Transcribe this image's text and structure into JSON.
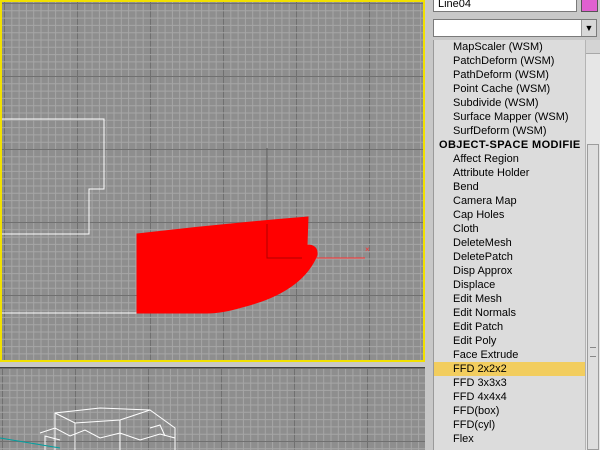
{
  "object_name": "Line04",
  "colors": {
    "grid_bg": "#8e8e8e",
    "grid_line": "#a6a6a6",
    "grid_major": "#707070",
    "active_border": "#f2e100",
    "shape_fill": "#ff0000",
    "outline": "#ffffff",
    "selected_item": "#f2cd5e",
    "object_color": "#e060d0"
  },
  "modifier_dropdown": {
    "value": "",
    "arrow_icon": "triangle-down-icon",
    "arrow_glyph": "▼"
  },
  "modifier_list": {
    "items": [
      {
        "type": "item",
        "label": "MapScaler (WSM)"
      },
      {
        "type": "item",
        "label": "PatchDeform (WSM)"
      },
      {
        "type": "item",
        "label": "PathDeform (WSM)"
      },
      {
        "type": "item",
        "label": "Point Cache (WSM)"
      },
      {
        "type": "item",
        "label": "Subdivide (WSM)"
      },
      {
        "type": "item",
        "label": "Surface Mapper (WSM)"
      },
      {
        "type": "item",
        "label": "SurfDeform (WSM)"
      },
      {
        "type": "header",
        "label": "OBJECT-SPACE MODIFIE"
      },
      {
        "type": "item",
        "label": "Affect Region"
      },
      {
        "type": "item",
        "label": "Attribute Holder"
      },
      {
        "type": "item",
        "label": "Bend"
      },
      {
        "type": "item",
        "label": "Camera Map"
      },
      {
        "type": "item",
        "label": "Cap Holes"
      },
      {
        "type": "item",
        "label": "Cloth"
      },
      {
        "type": "item",
        "label": "DeleteMesh"
      },
      {
        "type": "item",
        "label": "DeletePatch"
      },
      {
        "type": "item",
        "label": "Disp Approx"
      },
      {
        "type": "item",
        "label": "Displace"
      },
      {
        "type": "item",
        "label": "Edit Mesh"
      },
      {
        "type": "item",
        "label": "Edit Normals"
      },
      {
        "type": "item",
        "label": "Edit Patch"
      },
      {
        "type": "item",
        "label": "Edit Poly"
      },
      {
        "type": "item",
        "label": "Face Extrude"
      },
      {
        "type": "item",
        "label": "FFD 2x2x2",
        "selected": true
      },
      {
        "type": "item",
        "label": "FFD 3x3x3"
      },
      {
        "type": "item",
        "label": "FFD 4x4x4"
      },
      {
        "type": "item",
        "label": "FFD(box)"
      },
      {
        "type": "item",
        "label": "FFD(cyl)"
      },
      {
        "type": "item",
        "label": "Flex"
      }
    ]
  }
}
